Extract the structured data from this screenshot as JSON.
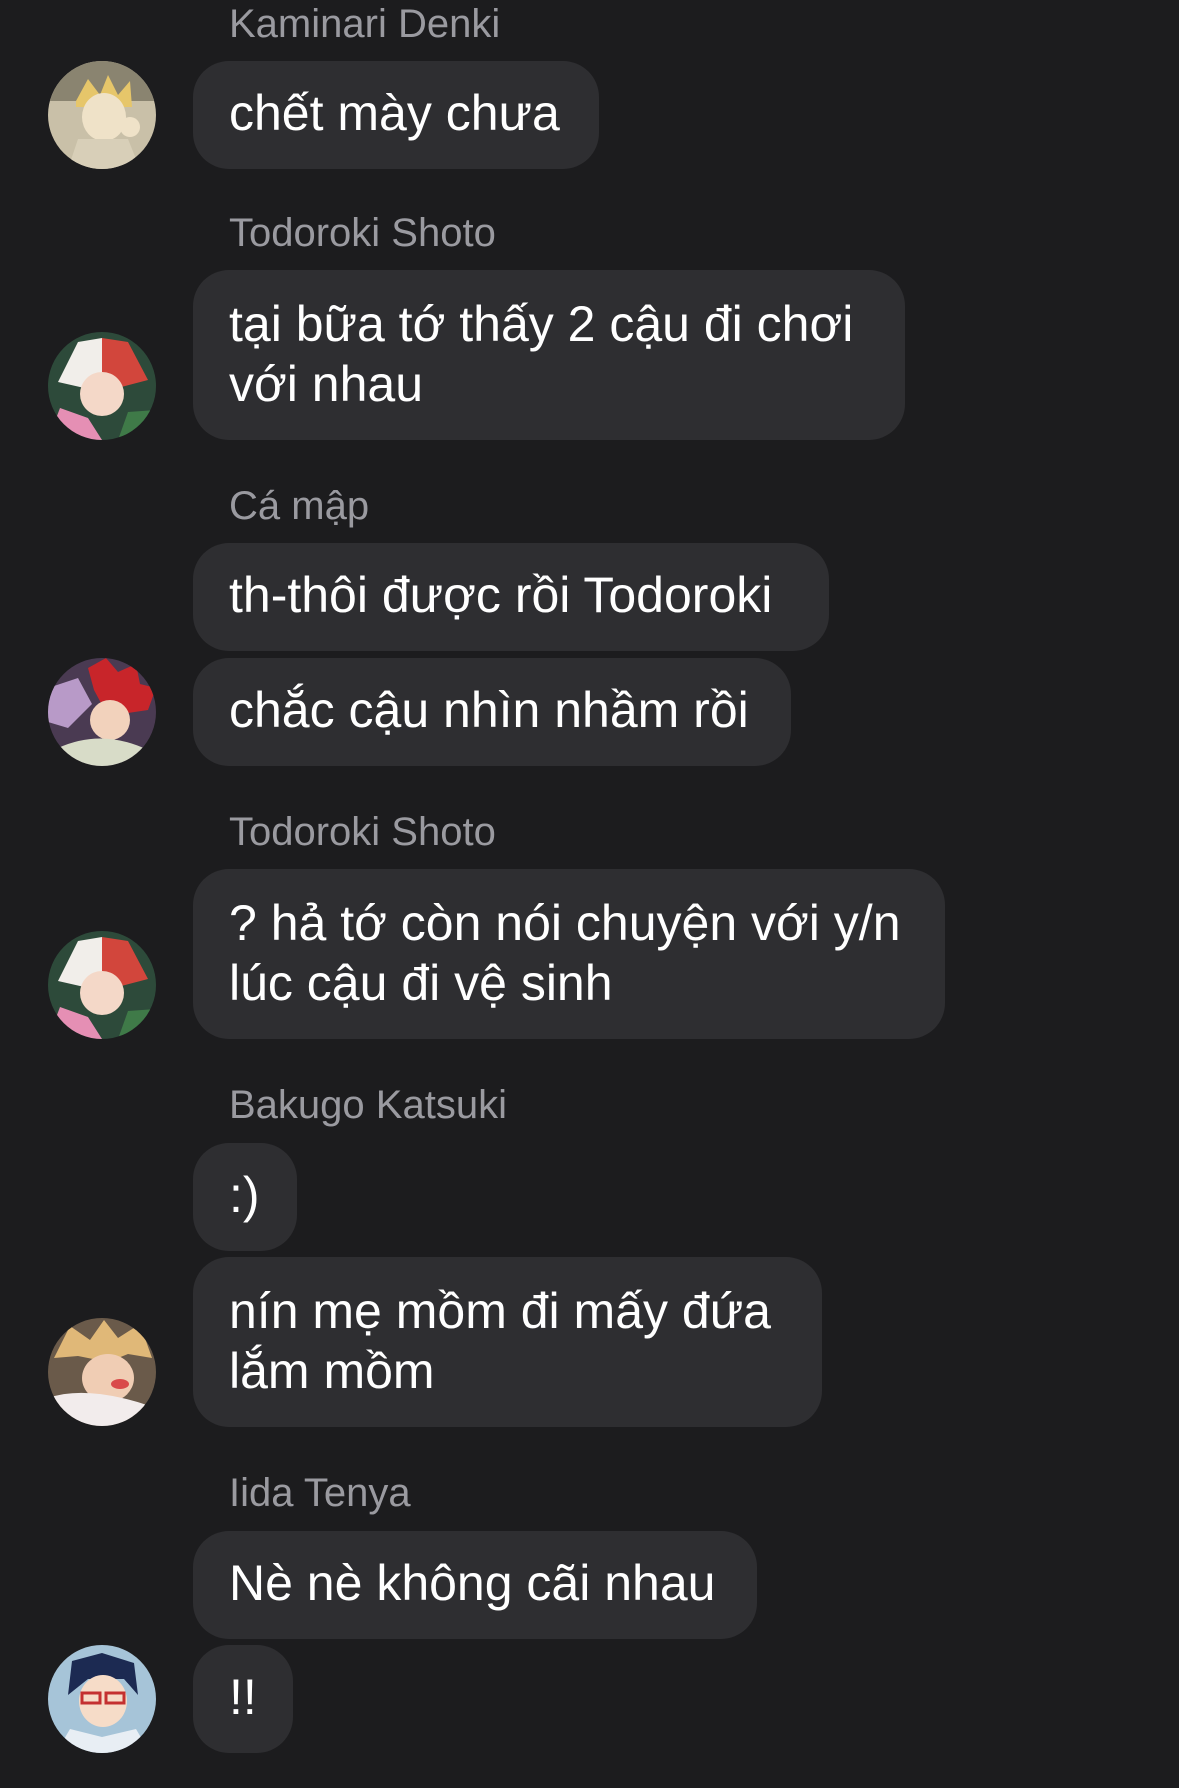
{
  "messages": [
    {
      "sender": "Kaminari Denki",
      "lines": [
        "chết mày chưa"
      ]
    },
    {
      "sender": "Todoroki Shoto",
      "lines": [
        "tại bữa tớ thấy 2 cậu đi chơi",
        "với nhau"
      ]
    },
    {
      "sender": "Cá mập",
      "lines": [
        "th-thôi được rồi Todoroki",
        "chắc cậu nhìn nhầm rồi"
      ]
    },
    {
      "sender": "Todoroki Shoto",
      "lines": [
        "? hả tớ còn nói chuyện với y/n",
        "lúc cậu đi vệ sinh"
      ]
    },
    {
      "sender": "Bakugo Katsuki",
      "lines": [
        ":)",
        "nín mẹ mồm đi mấy đứa",
        "lắm mồm"
      ]
    },
    {
      "sender": "Iida Tenya",
      "lines": [
        "Nè nè không cãi nhau",
        "!!"
      ]
    }
  ],
  "colors": {
    "background": "#1c1c1e",
    "bubble": "#2e2e31",
    "sender_name": "#9a9aa0",
    "message_text": "#ffffff"
  }
}
